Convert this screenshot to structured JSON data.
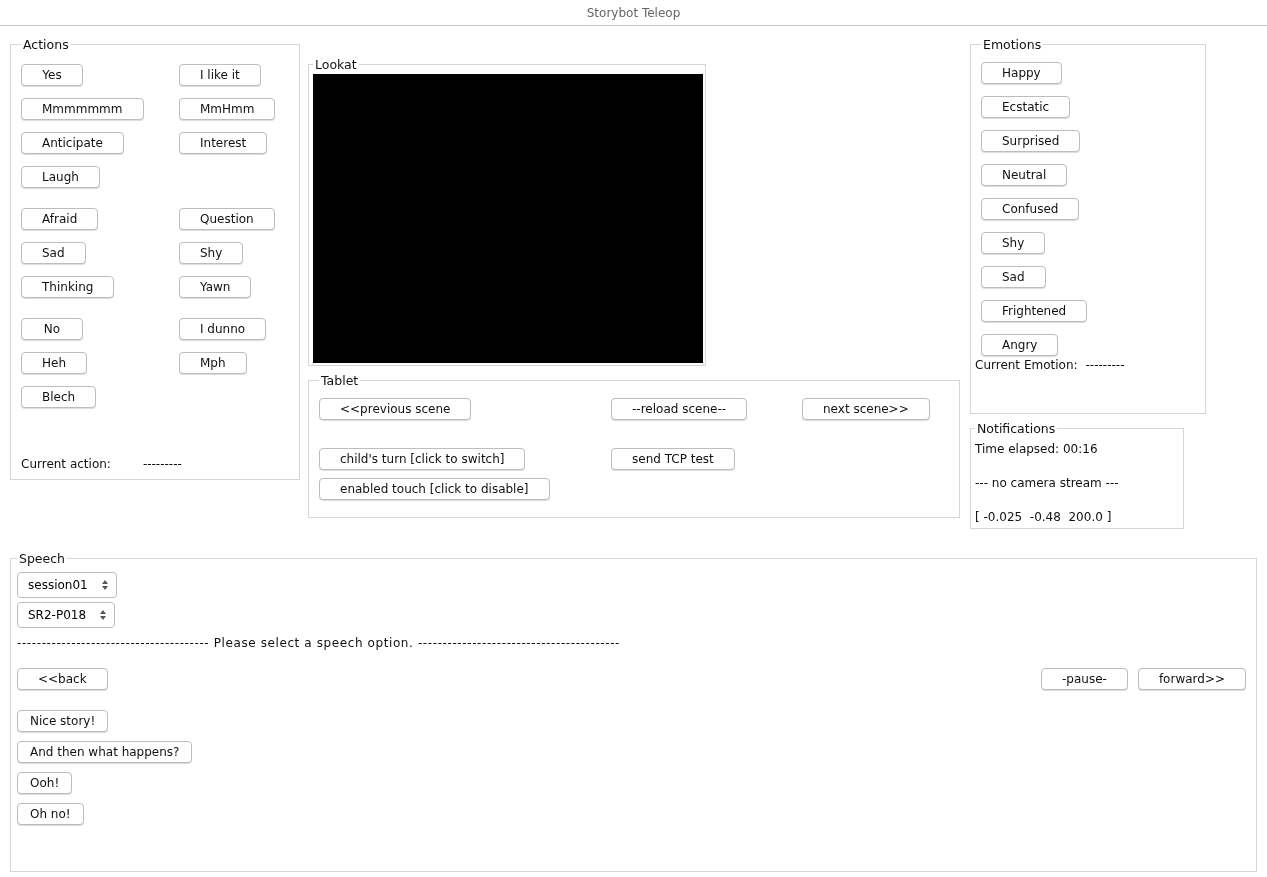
{
  "window": {
    "title": "Storybot Teleop"
  },
  "actions": {
    "title": "Actions",
    "groups": [
      [
        [
          "Yes",
          "I like it"
        ],
        [
          "Mmmmmmm",
          "MmHmm"
        ],
        [
          "Anticipate",
          "Interest"
        ],
        [
          "Laugh"
        ]
      ],
      [
        [
          "Afraid",
          "Question"
        ],
        [
          "Sad",
          "Shy"
        ],
        [
          "Thinking",
          "Yawn"
        ]
      ],
      [
        [
          "No",
          "I dunno"
        ],
        [
          "Heh",
          "Mph"
        ],
        [
          "Blech"
        ]
      ]
    ],
    "current_label": "Current action:",
    "current_value": "---------"
  },
  "lookat": {
    "title": "Lookat"
  },
  "tablet": {
    "title": "Tablet",
    "rows": [
      [
        "<<previous scene",
        "--reload scene--",
        "next scene>>"
      ],
      [
        "child's turn [click to switch]",
        "send TCP test"
      ],
      [
        "enabled touch [click to disable]"
      ]
    ]
  },
  "emotions": {
    "title": "Emotions",
    "buttons": [
      "Happy",
      "Ecstatic",
      "Surprised",
      "Neutral",
      "Confused",
      "Shy",
      "Sad",
      "Frightened",
      "Angry"
    ],
    "current_label": "Current Emotion:",
    "current_value": "---------"
  },
  "notifications": {
    "title": "Notifications",
    "lines": [
      "Time elapsed: 00:16",
      "--- no camera stream ---",
      "[ -0.025  -0.48  200.0 ]"
    ]
  },
  "speech": {
    "title": "Speech",
    "dropdowns": [
      {
        "value": "session01"
      },
      {
        "value": "SR2-P018"
      }
    ],
    "prompt": "--------------------------------------- Please select a speech option. -----------------------------------------",
    "nav_left": [
      "<<back"
    ],
    "nav_right": [
      "-pause-",
      "forward>>"
    ],
    "options": [
      "Nice story!",
      "And then what happens?",
      "Ooh!",
      "Oh no!"
    ]
  }
}
